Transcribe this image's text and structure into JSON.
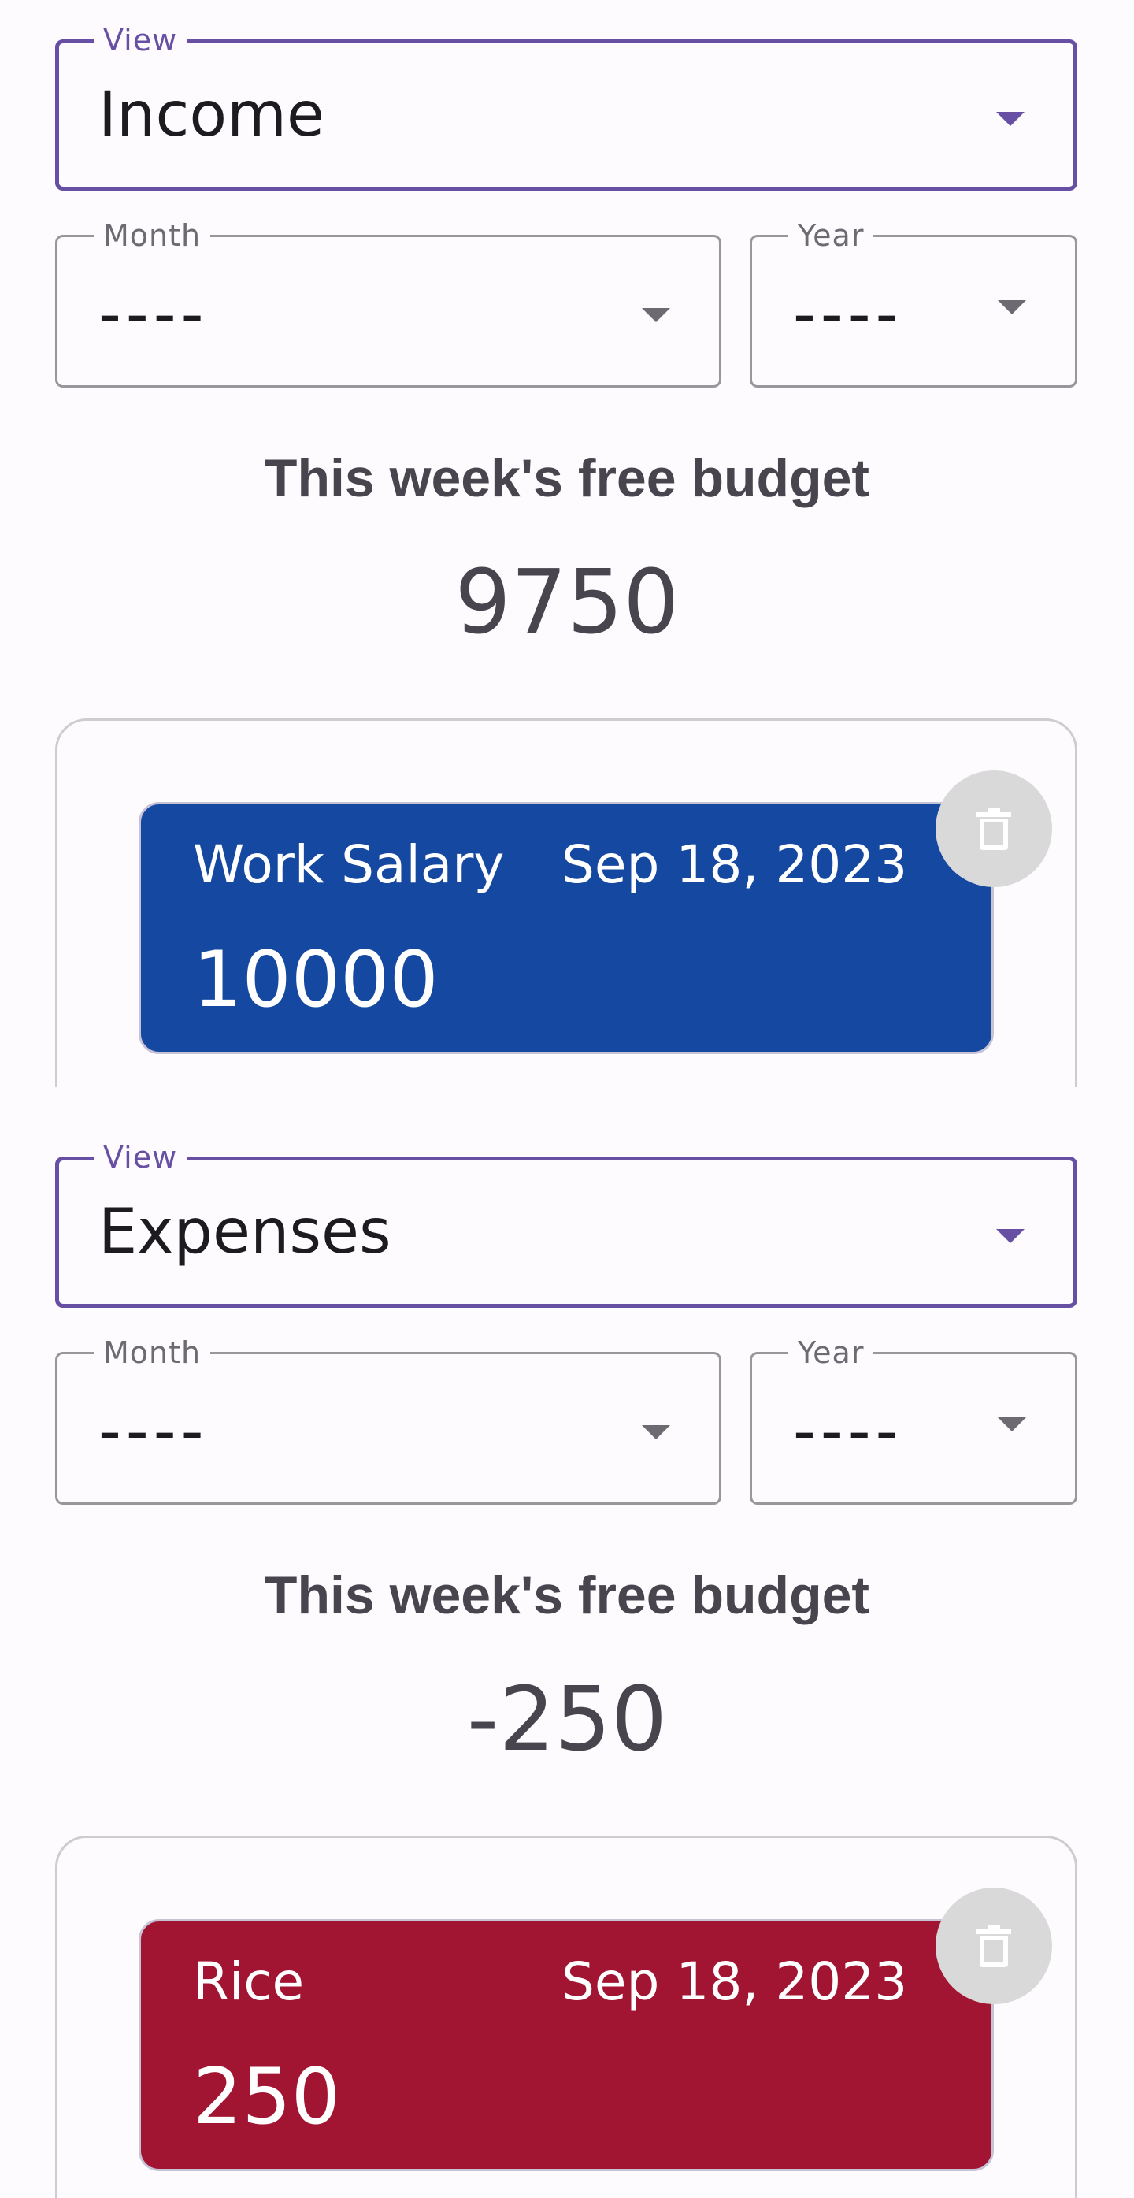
{
  "panels": [
    {
      "view_label": "View",
      "view_value": "Income",
      "month_label": "Month",
      "month_value": "----",
      "year_label": "Year",
      "year_value": "----",
      "budget_title": "This week's free budget",
      "budget_value": "9750",
      "entries": [
        {
          "name": "Work Salary",
          "date": "Sep 18, 2023",
          "amount": "10000",
          "type": "income",
          "color": "#1548a0"
        }
      ]
    },
    {
      "view_label": "View",
      "view_value": "Expenses",
      "month_label": "Month",
      "month_value": "----",
      "year_label": "Year",
      "year_value": "----",
      "budget_title": "This week's free budget",
      "budget_value": "-250",
      "entries": [
        {
          "name": "Rice",
          "date": "Sep 18, 2023",
          "amount": "250",
          "type": "expense",
          "color": "#a11532"
        }
      ]
    }
  ],
  "icons": {
    "dropdown": "chevron-down-icon",
    "delete": "trash-icon"
  },
  "colors": {
    "accent": "#6750a4",
    "income": "#1548a0",
    "expense": "#a11532",
    "background": "#fefbfe"
  }
}
